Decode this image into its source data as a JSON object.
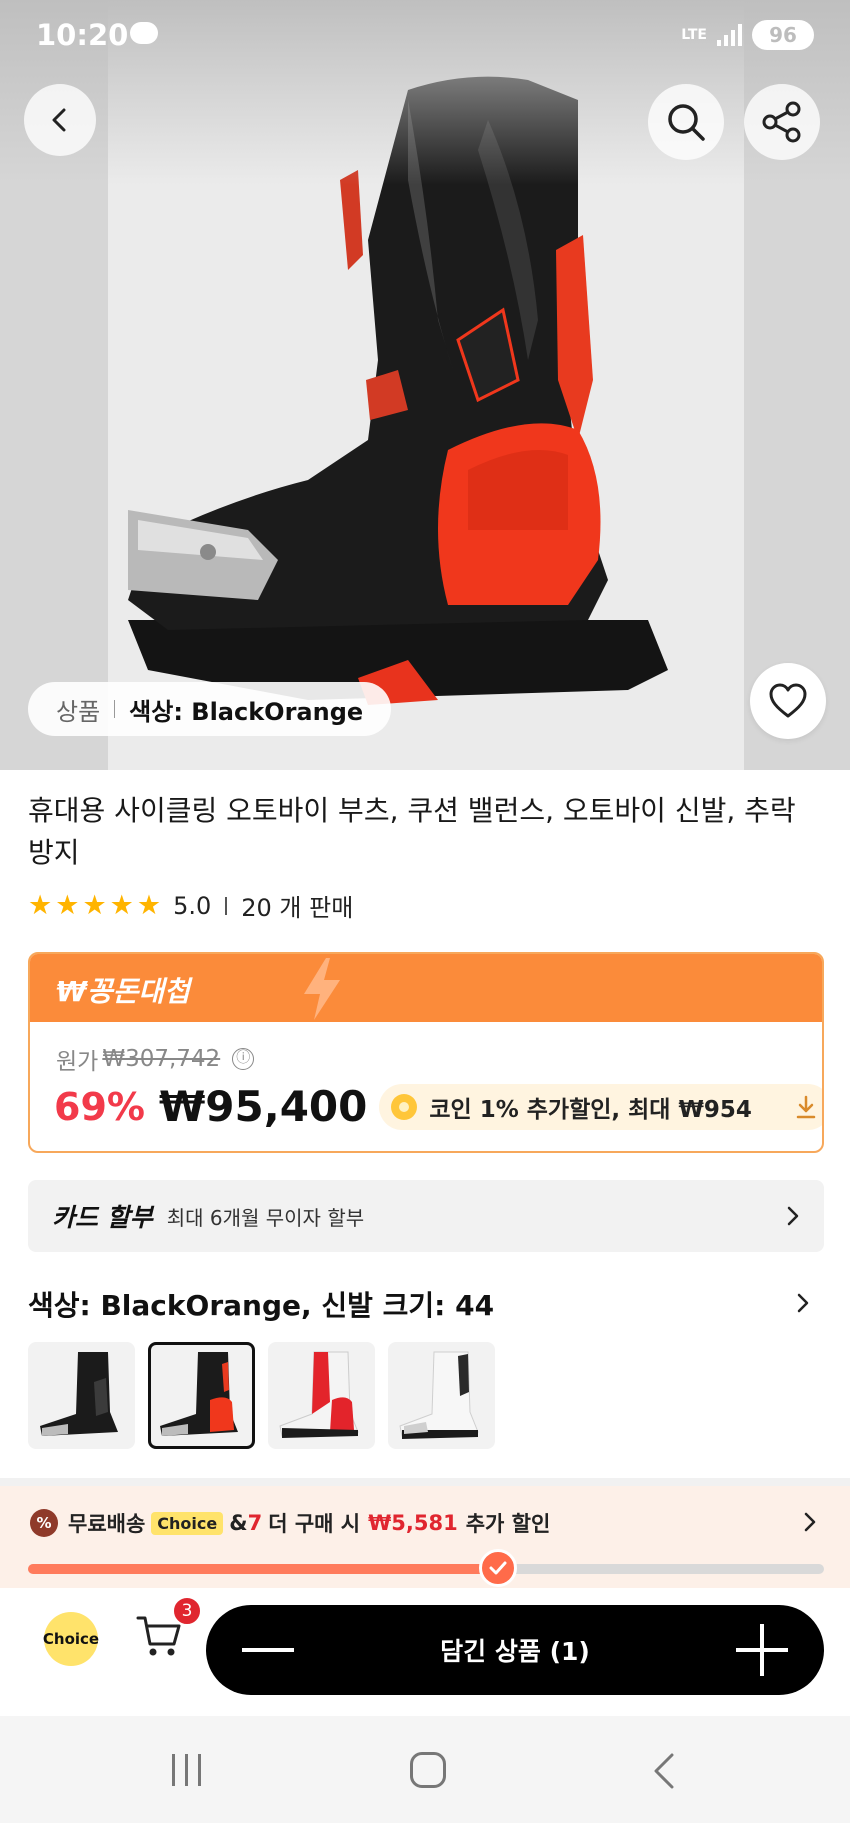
{
  "status_bar": {
    "time": "10:20",
    "network": "LTE",
    "battery": "96"
  },
  "hero": {
    "sku_tab": "상품",
    "sku_value": "색상: BlackOrange"
  },
  "product": {
    "title": "휴대용 사이클링 오토바이 부츠, 쿠션 밸런스, 오토바이 신발, 추락 방지",
    "rating": "5.0",
    "rating_stars": 5,
    "sold": "20 개 판매"
  },
  "price": {
    "deal_label": "₩꽁돈대첩",
    "original_label": "원가",
    "original_price": "₩307,742",
    "info_icon": "ⓘ",
    "discount": "69%",
    "sale_price": "₩95,400",
    "coin_text": "코인 1% 추가할인, 최대 ₩954"
  },
  "card": {
    "title": "카드 할부",
    "desc": "최대 6개월 무이자 할부"
  },
  "options": {
    "title": "색상: BlackOrange, 신발 크기: 44",
    "thumbnails": [
      {
        "name": "black",
        "selected": false
      },
      {
        "name": "black-orange",
        "selected": true
      },
      {
        "name": "red-white",
        "selected": false
      },
      {
        "name": "white",
        "selected": false
      }
    ]
  },
  "shipping": {
    "badge": "%",
    "free": "무료배송",
    "choice": "Choice",
    "amp": "&",
    "count": "7",
    "more": "더 구매 시",
    "amount": "₩5,581",
    "suffix": "추가 할인",
    "progress": 0.59
  },
  "action_bar": {
    "choice_label": "Choice",
    "cart_count": "3",
    "cart_button": "담긴 상품 (1)"
  },
  "colors": {
    "accent_orange": "#fb8b3a",
    "discount_red": "#f23a4a",
    "star": "#ffb400",
    "choice_yellow": "#ffe36b"
  },
  "icons": [
    "back-icon",
    "search-icon",
    "share-icon",
    "heart-icon",
    "star-icon",
    "info-icon",
    "coin-icon",
    "download-icon",
    "chevron-right-icon",
    "cart-icon",
    "minus-icon",
    "plus-icon",
    "check-icon"
  ]
}
